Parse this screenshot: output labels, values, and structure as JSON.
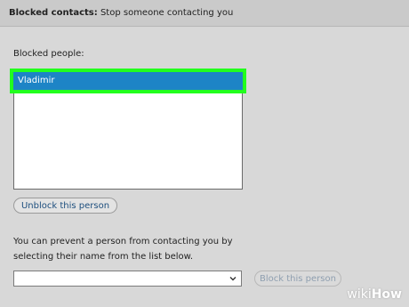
{
  "header": {
    "title": "Blocked contacts:",
    "subtitle": "Stop someone contacting you"
  },
  "blocked": {
    "label": "Blocked people:",
    "items": [
      {
        "name": "Vladimir",
        "selected": true
      }
    ],
    "unblock_label": "Unblock this person"
  },
  "prevent": {
    "text_line1": "You can prevent a person from contacting you by",
    "text_line2": "selecting their name from the list below.",
    "dropdown_value": "",
    "block_label": "Block this person"
  },
  "watermark": {
    "wiki": "wiki",
    "how": "How"
  },
  "colors": {
    "selection": "#1d84c6",
    "highlight": "#22ff1e",
    "link_text": "#1e4f7e"
  }
}
